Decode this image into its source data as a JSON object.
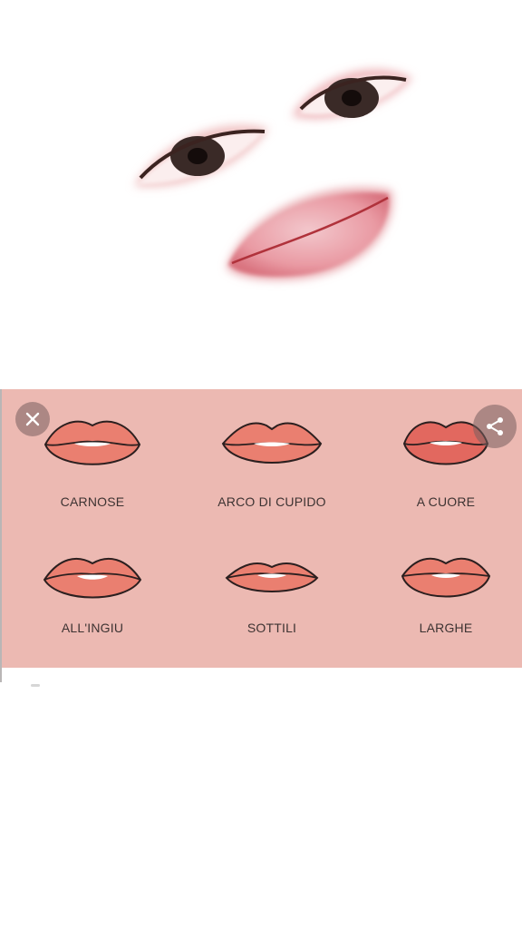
{
  "viewer": {
    "close_icon": "close-icon",
    "share_icon": "share-icon"
  },
  "lip_shapes": [
    {
      "label": "CARNOSE"
    },
    {
      "label": "ARCO DI CUPIDO"
    },
    {
      "label": "A CUORE"
    },
    {
      "label": "ALL'INGIU"
    },
    {
      "label": "SOTTILI"
    },
    {
      "label": "LARGHE"
    }
  ],
  "colors": {
    "card_background": "#ecb9b2",
    "lip_fill": "#ea7f70",
    "lip_fill_dark": "#e2685f",
    "outline": "#2b1f1f"
  }
}
